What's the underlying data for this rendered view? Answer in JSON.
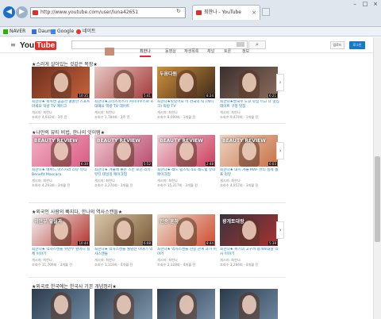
{
  "browser": {
    "address": "http://www.youtube.com/user/luna42651",
    "tab_title": "최한나 - YouTube",
    "favorites": [
      "NAVER",
      "Daum",
      "Google",
      "네이트"
    ],
    "win_controls": [
      "–",
      "□",
      "×"
    ]
  },
  "youtube": {
    "logo_you": "You",
    "logo_tube": "Tube",
    "upload_label": "업로드",
    "login_label": "로그인",
    "channel_tabs": [
      "최한나",
      "동영상",
      "재생목록",
      "채널",
      "토론",
      "정보"
    ]
  },
  "sections": [
    {
      "title": "★스러게 살아있는 것같은 목장★",
      "videos": [
        {
          "caption": "",
          "duration": "10:35",
          "title": "최한나★ 숙취엔 곰곰한 꿀꿀한 스포트 마세요 먹방 TV 메이크",
          "meta1": "게시자: 최한나",
          "meta2": "조회수 4,932회 · 3주 전",
          "colors": [
            "#6b2f1e",
            "#c8623c"
          ]
        },
        {
          "caption": "",
          "duration": "5:41",
          "title": "최한나★크리스마스가 커피하우스로 초대해요 먹방 TV 데이트",
          "meta1": "게시자: 최한나",
          "meta2": "조회수 1,784회 · 3주 전",
          "colors": [
            "#e6c9c4",
            "#a43a3a"
          ]
        },
        {
          "caption": "두움다원",
          "duration": "8:24",
          "title": "최한나★맛있어요 이 천국의 떡 (메이크) 먹방 TV",
          "meta1": "게시자: 최한나",
          "meta2": "조회수 8,099회 · 1개월 전",
          "colors": [
            "#d2913d",
            "#3b2a1a"
          ]
        },
        {
          "caption": "",
          "duration": "6:21",
          "title": "최한나★쌀국수 도쿄 맛집 이고 나 맛집 데이트 구정 맛집",
          "meta1": "게시자: 최한나",
          "meta2": "조회수 9,474회 · 1개월 전",
          "colors": [
            "#3b2f2f",
            "#8a6d5b"
          ]
        }
      ]
    },
    {
      "title": "★나만의 뷰티 비법, 한나의 잇이템★",
      "videos": [
        {
          "caption": "BEAUTY REVIEW",
          "duration": "6:30",
          "title": "최한나★ 에뛰드 마스카라 리뷰 뷰티 Benefit Mascara",
          "meta1": "게시자: 최한나",
          "meta2": "조회수 4,293회 · 3개월 전",
          "colors": [
            "#f3b0c3",
            "#d75b84"
          ]
        },
        {
          "caption": "BEAUTY REVIEW",
          "duration": "5:52",
          "title": "최한나★ 겨울에 좋은 스킨 로션 리뷰 뷰티 데일리 메이크업",
          "meta1": "게시자: 최한나",
          "meta2": "조회수 3,274회 · 3개월 전",
          "colors": [
            "#f0c9d0",
            "#b84a6e"
          ]
        },
        {
          "caption": "BEAUTY REVIEW",
          "duration": "2:48",
          "title": "최한나★ 레드 립스틱 4호 레드빛 뷰티 메이크업",
          "meta1": "게시자: 최한나",
          "meta2": "조회수 15,317회 · 3개월 전",
          "colors": [
            "#f0d3da",
            "#cc3b5b"
          ]
        },
        {
          "caption": "BEAUTY REVIEW",
          "duration": "6:03",
          "title": "최한나★ 대시 겨울 MAF 뷰티 실제 셀프 리뷰",
          "meta1": "게시자: 최한나",
          "meta2": "조회수 4,957회 · 3개월 전",
          "colors": [
            "#eed3c4",
            "#c77043"
          ]
        }
      ]
    },
    {
      "title": "★외국인 사람의 빠지다, 한나의 역사스캔들★",
      "videos": [
        {
          "caption": "위안부 할실과",
          "duration": "10:44",
          "title": "최한나★ 역사스캔들 위안부 할머니 실체 이야기",
          "meta1": "게시자: 최한나",
          "meta2": "조회수 11,709회 · 3개월 전",
          "colors": [
            "#f4f4f4",
            "#b3322c"
          ]
        },
        {
          "caption": "",
          "duration": "6:08",
          "title": "최한나★ 역사스캔들 월남전 이야기 역사스캔들",
          "meta1": "게시자: 최한나",
          "meta2": "조회수 1,118회 · 4개월 전",
          "colors": [
            "#d9c7a8",
            "#7a5a3a"
          ]
        },
        {
          "caption": "한중 훈하",
          "duration": "8:44",
          "title": "최한나★ 역사스캔들 한중 관계 과거 이야기",
          "meta1": "게시자: 최한나",
          "meta2": "조회수 2,128회 · 4개월 전",
          "colors": [
            "#eadfcf",
            "#d04a2f"
          ]
        },
        {
          "caption": "광개토대왕",
          "duration": "5:39",
          "title": "최한나★ 위기의 고구려 광개토대왕 역사 이야기",
          "meta1": "게시자: 최한나",
          "meta2": "조회수 3,284회 · 4개월 전",
          "colors": [
            "#3a3340",
            "#a8322f"
          ]
        }
      ]
    },
    {
      "title": "★외국로 한국에는 한국사 기본 개념정리★",
      "videos": [
        {
          "caption": "",
          "duration": "",
          "title": "",
          "meta1": "",
          "meta2": "",
          "colors": [
            "#2b3b4b",
            "#6f8aa3"
          ]
        },
        {
          "caption": "",
          "duration": "",
          "title": "",
          "meta1": "",
          "meta2": "",
          "colors": [
            "#31404f",
            "#7d96ac"
          ]
        },
        {
          "caption": "",
          "duration": "",
          "title": "",
          "meta1": "",
          "meta2": "",
          "colors": [
            "#2d3c4c",
            "#7890a8"
          ]
        },
        {
          "caption": "",
          "duration": "",
          "title": "",
          "meta1": "",
          "meta2": "",
          "colors": [
            "#2a3948",
            "#6e879f"
          ]
        }
      ]
    }
  ]
}
